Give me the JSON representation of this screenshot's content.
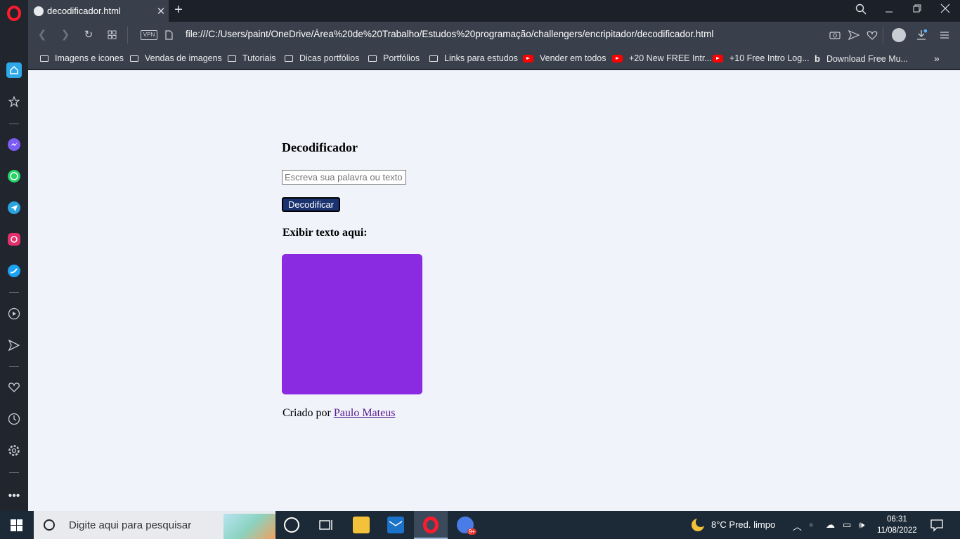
{
  "browser": {
    "tab_title": "decodificador.html",
    "url": "file:///C:/Users/paint/OneDrive/Área%20de%20Trabalho/Estudos%20programação/challengers/encripitador/decodificador.html",
    "vpn_label": "VPN",
    "bookmarks": [
      {
        "label": "Imagens e icones",
        "type": "folder"
      },
      {
        "label": "Vendas de imagens",
        "type": "folder"
      },
      {
        "label": "Tutoriais",
        "type": "folder"
      },
      {
        "label": "Dicas portfólios",
        "type": "folder"
      },
      {
        "label": "Portfólios",
        "type": "folder"
      },
      {
        "label": "Links para estudos",
        "type": "folder"
      },
      {
        "label": "Vender em todos",
        "type": "youtube"
      },
      {
        "label": "+20 New FREE Intr...",
        "type": "youtube"
      },
      {
        "label": "+10 Free Intro Log...",
        "type": "youtube"
      },
      {
        "label": "Download Free Mu...",
        "type": "bing"
      }
    ]
  },
  "page": {
    "heading": "Decodificador",
    "input_placeholder": "Escreva sua palavra ou texto",
    "button_label": "Decodificar",
    "output_label": "Exibir texto aqui:",
    "output_box_color": "#8a2be2",
    "credit_prefix": "Criado por",
    "credit_link": "Paulo Mateus"
  },
  "taskbar": {
    "search_placeholder": "Digite aqui para pesquisar",
    "weather": "8°C  Pred. limpo",
    "time": "06:31",
    "date": "11/08/2022"
  },
  "colors": {
    "button_bg": "#1a3270",
    "page_bg": "#f1f3fb",
    "opera_red": "#ff1b2d"
  }
}
